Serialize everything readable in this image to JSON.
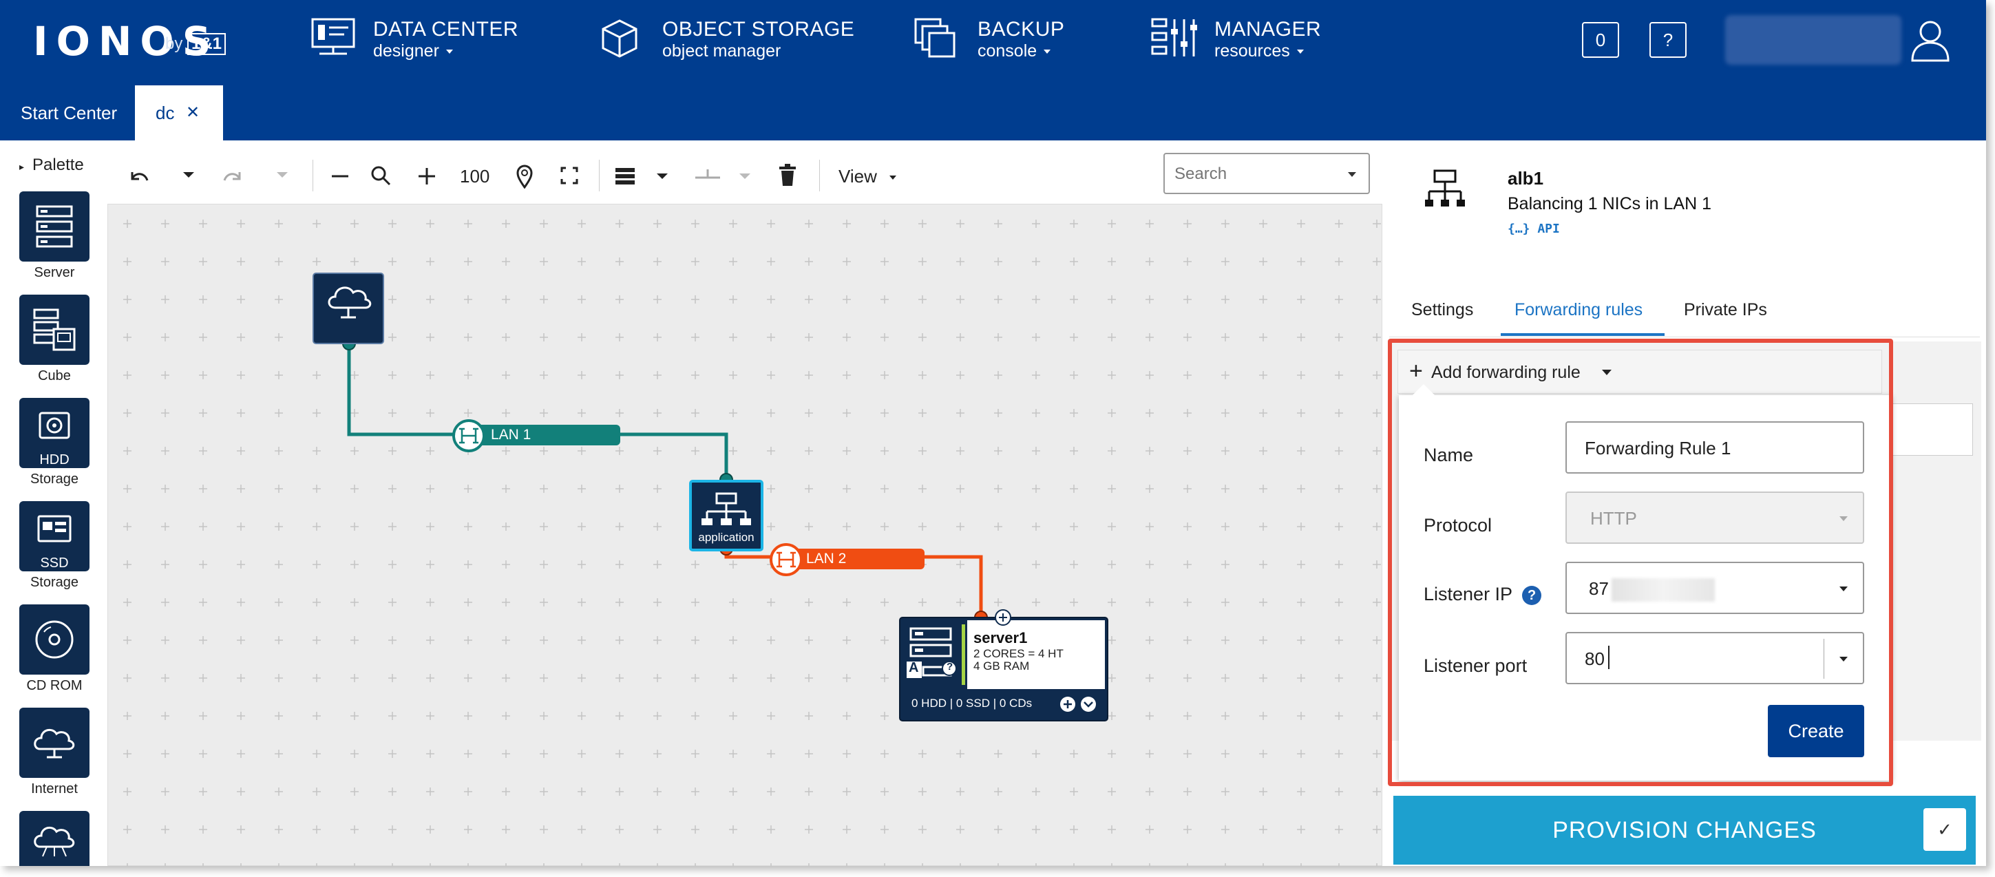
{
  "header": {
    "logo": "IONOS",
    "logo_by": "by",
    "logo_brand": "1&1",
    "nav": [
      {
        "title": "DATA CENTER",
        "sub": "designer",
        "icon": "data-center-icon"
      },
      {
        "title": "OBJECT STORAGE",
        "sub": "object manager",
        "icon": "object-storage-icon"
      },
      {
        "title": "BACKUP",
        "sub": "console",
        "icon": "backup-icon"
      },
      {
        "title": "MANAGER",
        "sub": "resources",
        "icon": "manager-icon"
      }
    ],
    "counter": "0",
    "help": "?"
  },
  "tabs": [
    {
      "label": "Start Center"
    },
    {
      "label": "dc",
      "close": "✕"
    }
  ],
  "palette": {
    "heading": "Palette",
    "items": [
      {
        "label": "Server"
      },
      {
        "label": "Cube"
      },
      {
        "label": "HDD",
        "label2": "Storage"
      },
      {
        "label": "SSD",
        "label2": "Storage"
      },
      {
        "label": "CD ROM"
      },
      {
        "label": "Internet"
      }
    ]
  },
  "toolbar": {
    "zoom": "100",
    "view_label": "View",
    "search_placeholder": "Search"
  },
  "canvas": {
    "lan1_label": "LAN 1",
    "lan2_label": "LAN 2",
    "lb_label": "application",
    "server": {
      "name": "server1",
      "cores": "2 CORES = 4 HT",
      "ram": "4 GB RAM",
      "footer": "0 HDD | 0 SSD | 0 CDs",
      "badge": "A"
    },
    "colors": {
      "lan1": "#12807a",
      "lan2": "#f04d12",
      "node": "#0f2b4e"
    }
  },
  "panel": {
    "title": "alb1",
    "subtitle": "Balancing 1 NICs in LAN 1",
    "api": "{…} API",
    "tabs": [
      "Settings",
      "Forwarding rules",
      "Private IPs"
    ],
    "active_tab": "Forwarding rules",
    "add_rule": "Add forwarding rule",
    "form": {
      "name_label": "Name",
      "name_value": "Forwarding Rule 1",
      "protocol_label": "Protocol",
      "protocol_value": "HTTP",
      "listener_ip_label": "Listener IP",
      "listener_ip_value": "87",
      "listener_port_label": "Listener port",
      "listener_port_value": "80"
    },
    "create_label": "Create",
    "provision_label": "PROVISION CHANGES",
    "check": "✓"
  }
}
